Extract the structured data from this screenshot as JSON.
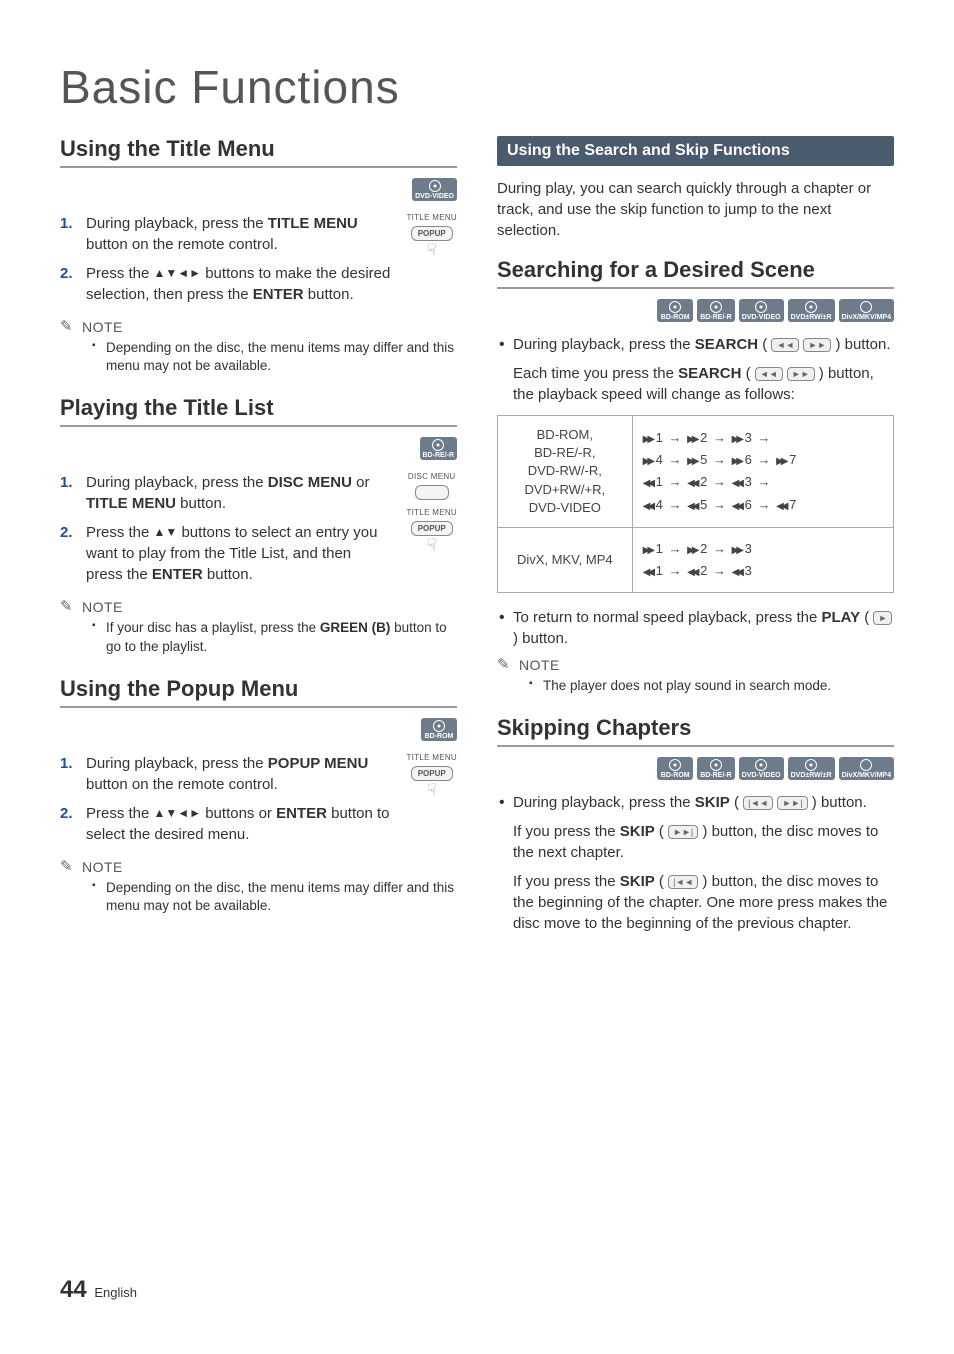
{
  "page_title": "Basic Functions",
  "page_number": "44",
  "page_lang": "English",
  "note_label": "NOTE",
  "remote": {
    "title_menu": "TITLE MENU",
    "popup": "POPUP",
    "disc_menu": "DISC MENU"
  },
  "badges": {
    "bdrom": "BD-ROM",
    "bdre": "BD-RE/-R",
    "dvdvideo": "DVD-VIDEO",
    "dvdrw": "DVD±RW/±R",
    "divx": "DivX/MKV/MP4"
  },
  "left": {
    "s1": {
      "title": "Using the Title Menu",
      "step1_a": "During playback, press the ",
      "step1_b": "TITLE MENU",
      "step1_c": " button on the remote control.",
      "step2_a": "Press the ",
      "step2_b": " buttons to make the desired selection, then press the ",
      "step2_c": "ENTER",
      "step2_d": " button.",
      "note1": "Depending on the disc, the menu items may differ and this menu may not be available."
    },
    "s2": {
      "title": "Playing the Title List",
      "step1_a": "During playback, press the ",
      "step1_b": "DISC MENU",
      "step1_c": " or ",
      "step1_d": "TITLE MENU",
      "step1_e": " button.",
      "step2_a": "Press the ",
      "step2_b": " buttons to select an entry you want to play from the Title List, and then press the ",
      "step2_c": "ENTER",
      "step2_d": " button.",
      "note1_a": "If your disc has a playlist, press the ",
      "note1_b": "GREEN (B)",
      "note1_c": " button to go to the playlist."
    },
    "s3": {
      "title": "Using the Popup Menu",
      "step1_a": "During playback, press the ",
      "step1_b": "POPUP MENU",
      "step1_c": " button on the remote control.",
      "step2_a": "Press the ",
      "step2_b": " buttons or ",
      "step2_c": "ENTER",
      "step2_d": " button to select the desired menu.",
      "note1": "Depending on the disc, the menu items may differ and this menu may not be available."
    }
  },
  "right": {
    "bar_title": "Using the Search and Skip Functions",
    "intro": "During play, you can search quickly through a chapter or track, and use the skip function to jump to the next selection.",
    "s1": {
      "title": "Searching for a Desired Scene",
      "b1_a": "During playback, press the ",
      "b1_b": "SEARCH",
      "b1_c": " button.",
      "sub_a": "Each time you press the ",
      "sub_b": "SEARCH",
      "sub_c": " button, the playback speed will change as follows:",
      "row1_label": "BD-ROM,\nBD-RE/-R,\nDVD-RW/-R,\nDVD+RW/+R,\nDVD-VIDEO",
      "row2_label": "DivX, MKV, MP4",
      "b2_a": "To return to normal speed playback, press the ",
      "b2_b": "PLAY",
      "b2_c": " button.",
      "note1": "The player does not play sound in search mode."
    },
    "s2": {
      "title": "Skipping Chapters",
      "b1_a": "During playback, press the ",
      "b1_b": "SKIP",
      "b1_c": " button.",
      "sub1_a": "If you press the ",
      "sub1_b": "SKIP",
      "sub1_c": " button, the disc moves to the next chapter.",
      "sub2_a": "If you press the ",
      "sub2_b": "SKIP",
      "sub2_c": " button, the disc moves to the beginning of the chapter. One more press makes the disc move to the beginning of the previous chapter."
    }
  }
}
